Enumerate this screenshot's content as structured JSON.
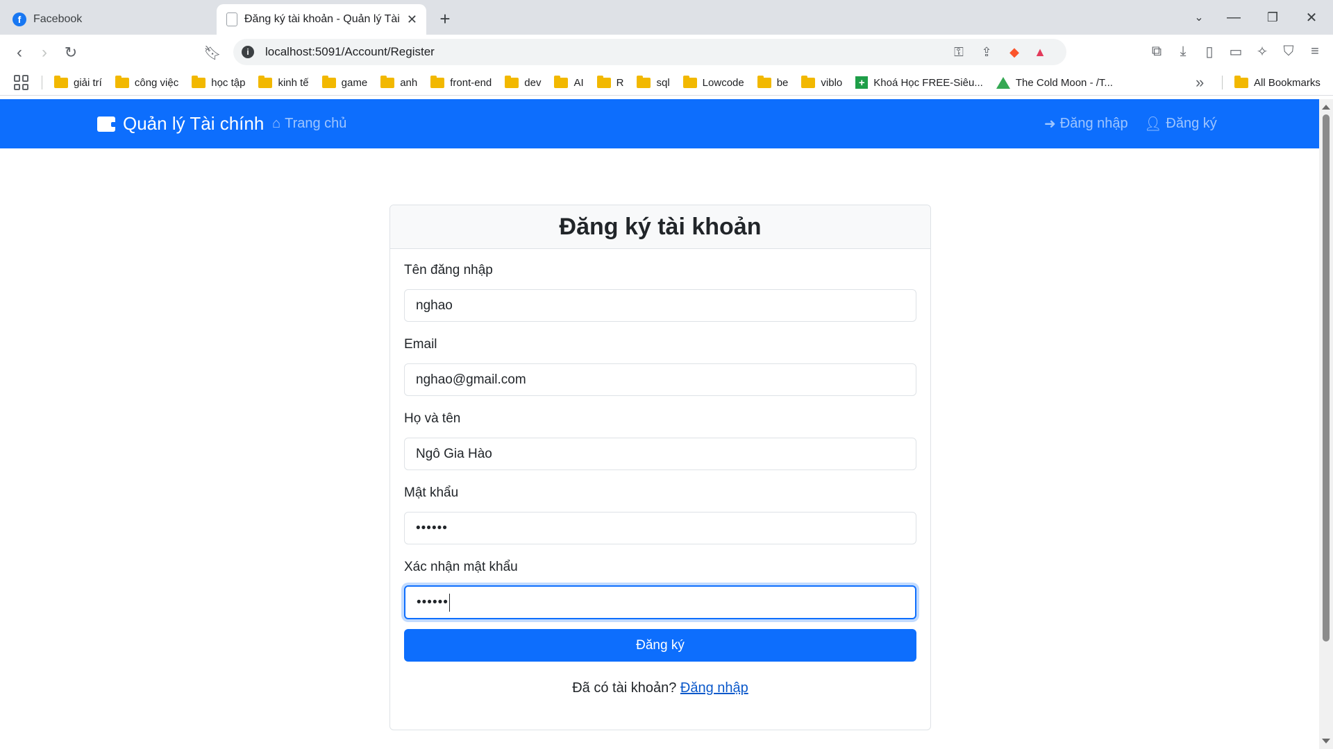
{
  "browser": {
    "tabs": [
      {
        "title": "Facebook",
        "active": false
      },
      {
        "title": "Đăng ký tài khoản - Quản lý Tài c",
        "active": true
      }
    ],
    "url": "localhost:5091/Account/Register",
    "bookmarks": [
      "giải trí",
      "công việc",
      "học tập",
      "kinh tế",
      "game",
      "anh",
      "front-end",
      "dev",
      "AI",
      "R",
      "sql",
      "Lowcode",
      "be",
      "viblo",
      "Khoá Học FREE-Siêu...",
      "The Cold Moon - /T..."
    ],
    "all_bookmarks": "All Bookmarks"
  },
  "navbar": {
    "brand": "Quản lý Tài chính",
    "home": "Trang chủ",
    "login": "Đăng nhập",
    "register": "Đăng ký",
    "color": "#0d6efd"
  },
  "form": {
    "title": "Đăng ký tài khoản",
    "username_label": "Tên đăng nhập",
    "username_value": "nghao",
    "email_label": "Email",
    "email_value": "nghao@gmail.com",
    "fullname_label": "Họ và tên",
    "fullname_value": "Ngô Gia Hào",
    "password_label": "Mật khẩu",
    "password_value": "••••••",
    "confirm_label": "Xác nhận mật khẩu",
    "confirm_value": "••••••",
    "submit": "Đăng ký",
    "have_account": "Đã có tài khoản?",
    "login_link": "Đăng nhập"
  }
}
